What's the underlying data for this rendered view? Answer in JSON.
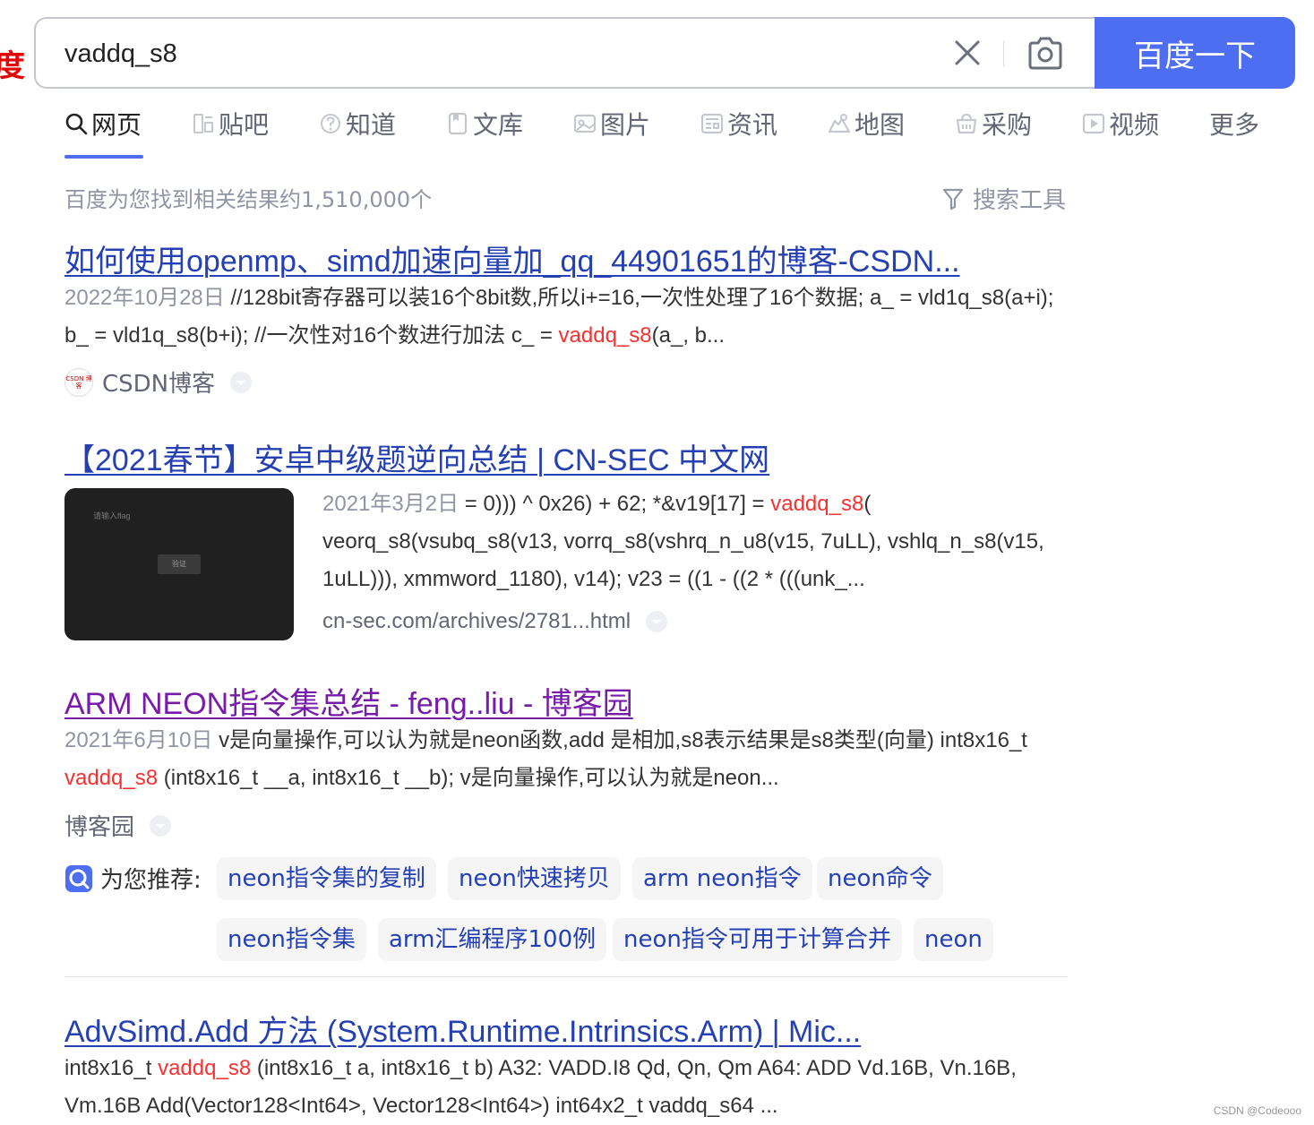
{
  "logo_fragment": "度",
  "search": {
    "query": "vaddq_s8",
    "button_label": "百度一下"
  },
  "tabs": [
    {
      "label": "网页",
      "icon": "search-icon",
      "active": true
    },
    {
      "label": "贴吧",
      "icon": "tieba-icon"
    },
    {
      "label": "知道",
      "icon": "question-icon"
    },
    {
      "label": "文库",
      "icon": "document-icon"
    },
    {
      "label": "图片",
      "icon": "image-icon"
    },
    {
      "label": "资讯",
      "icon": "news-icon"
    },
    {
      "label": "地图",
      "icon": "map-icon"
    },
    {
      "label": "采购",
      "icon": "shopping-bag-icon"
    },
    {
      "label": "视频",
      "icon": "video-icon"
    },
    {
      "label": "更多",
      "icon": ""
    }
  ],
  "result_count": "百度为您找到相关结果约1,510,000个",
  "search_tools_label": "搜索工具",
  "results": [
    {
      "title": "如何使用openmp、simd加速向量加_qq_44901651的博客-CSDN...",
      "date": "2022年10月28日",
      "snippet_before": " //128bit寄存器可以装16个8bit数,所以i+=16,一次性处理了16个数据; a_ = vld1q_s8(a+i); b_ = vld1q_s8(b+i); //一次性对16个数进行加法 c_ = ",
      "highlight": "vaddq_s8",
      "snippet_after": "(a_, b...",
      "source": "CSDN博客",
      "source_logo_text": "CSDN 博客"
    },
    {
      "title": "【2021春节】安卓中级题逆向总结 | CN-SEC 中文网",
      "date": "2021年3月2日",
      "snippet_before": " = 0))) ^ 0x26) + 62; *&v19[17] = ",
      "highlight": "vaddq_s8",
      "snippet_after": "( veorq_s8(vsubq_s8(v13, vorrq_s8(vshrq_n_u8(v15, 7uLL), vshlq_n_s8(v15, 1uLL))), xmmword_1180), v14); v23 = ((1 - ((2 * (((unk_...",
      "url": "cn-sec.com/archives/2781...html",
      "thumb_text": "请输入flag",
      "thumb_button": "验证"
    },
    {
      "title": "ARM NEON指令集总结 - feng..liu - 博客园",
      "date": "2021年6月10日",
      "snippet_before": " v是向量操作,可以认为就是neon函数,add 是相加,s8表示结果是s8类型(向量) int8x16_t ",
      "highlight": "vaddq_s8",
      "snippet_after": " (int8x16_t __a, int8x16_t __b); v是向量操作,可以认为就是neon...",
      "source": "博客园"
    },
    {
      "title": "AdvSimd.Add 方法 (System.Runtime.Intrinsics.Arm) | Mic...",
      "snippet_before": "int8x16_t ",
      "highlight": "vaddq_s8",
      "snippet_after": " (int8x16_t a, int8x16_t b) A32: VADD.I8 Qd, Qn, Qm A64: ADD Vd.16B, Vn.16B, Vm.16B Add(Vector128<Int64>, Vector128<Int64>) int64x2_t vaddq_s64 ..."
    }
  ],
  "recommend": {
    "label": "为您推荐:",
    "chips": [
      "neon指令集的复制",
      "neon快速拷贝",
      "arm neon指令",
      "neon命令",
      "neon指令集",
      "arm汇编程序100例",
      "neon指令可用于计算合并",
      "neon"
    ]
  },
  "watermark": "CSDN @Codeooo",
  "colors": {
    "accent": "#4e6ef2",
    "link": "#2440b3",
    "visited": "#771caa",
    "highlight": "#f73131",
    "muted": "#9195a3"
  }
}
